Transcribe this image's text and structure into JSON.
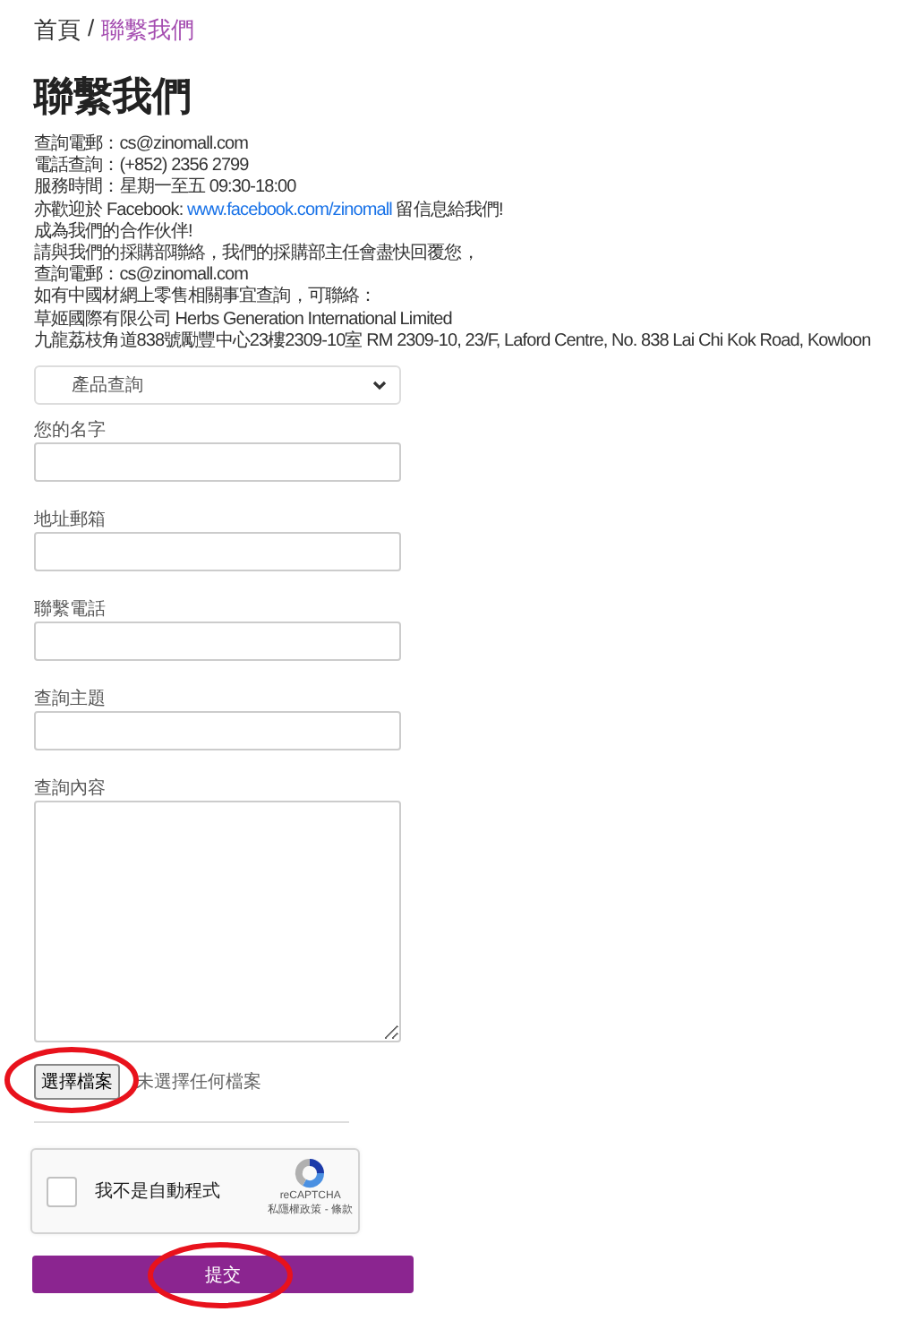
{
  "breadcrumb": {
    "home": "首頁",
    "separator": "/",
    "current": "聯繫我們"
  },
  "title": "聯繫我們",
  "info_lines": [
    "查詢電郵：cs@zinomall.com",
    "電話查詢：(+852) 2356 2799",
    "服務時間：星期一至五 09:30-18:00",
    {
      "prefix": "亦歡迎於 Facebook: ",
      "link": "www.facebook.com/zinomall",
      "suffix": " 留信息給我們!"
    },
    "成為我們的合作伙伴!",
    "請與我們的採購部聯絡，我們的採購部主任會盡快回覆您，",
    "查詢電郵：cs@zinomall.com",
    "如有中國材網上零售相關事宜查詢，可聯絡：",
    "草姬國際有限公司 Herbs Generation International Limited",
    "九龍荔枝角道838號勵豐中心23樓2309-10室 RM 2309-10, 23/F, Laford Centre, No. 838 Lai Chi Kok Road, Kowloon"
  ],
  "select": {
    "value": "產品查詢"
  },
  "fields": [
    {
      "label": "您的名字",
      "kind": "input"
    },
    {
      "label": "地址郵箱",
      "kind": "input"
    },
    {
      "label": "聯繫電話",
      "kind": "input"
    },
    {
      "label": "查詢主題",
      "kind": "input"
    },
    {
      "label": "查詢內容",
      "kind": "textarea"
    }
  ],
  "file_upload": {
    "button": "選擇檔案",
    "status": "未選擇任何檔案",
    "circled": true
  },
  "recaptcha": {
    "label": "我不是自動程式",
    "checked": false,
    "brand": "reCAPTCHA",
    "links": "私隱權政策 - 條款"
  },
  "submit": {
    "label": "提交",
    "circled": true
  }
}
